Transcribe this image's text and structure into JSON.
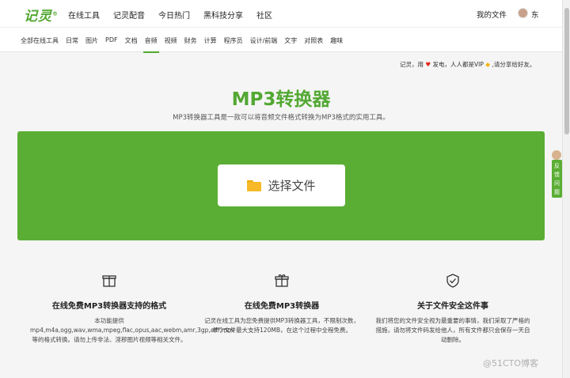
{
  "header": {
    "logo": "记灵",
    "logo_mark": "®",
    "nav": [
      "在线工具",
      "记灵配音",
      "今日热门",
      "黑科技分享",
      "社区"
    ],
    "my_files": "我的文件",
    "username": "东"
  },
  "categories": {
    "items": [
      "全部在线工具",
      "日常",
      "图片",
      "PDF",
      "文档",
      "音频",
      "视频",
      "财务",
      "计算",
      "程序员",
      "设计/前端",
      "文字",
      "对照表",
      "趣味"
    ],
    "active": "音频"
  },
  "notice": {
    "part1": "记灵，用",
    "heart": "♥",
    "part2": "发电，人人都是VIP",
    "vip": "◆",
    "part3": ",请分享给好友。"
  },
  "main": {
    "title": "MP3转换器",
    "subtitle": "MP3转换器工具是一款可以将音频文件格式转换为MP3格式的实用工具。",
    "select_label": "选择文件"
  },
  "features": [
    {
      "icon": "box-icon",
      "title": "在线免费MP3转换器支持的格式",
      "desc": "本功能提供mp4,m4a,ogg,wav,wma,mpeg,flac,opus,aac,webm,amr,3gp,aiff,mov等的格式转换。请勿上传非法、淫秽图片视频等相关文件。"
    },
    {
      "icon": "gift-icon",
      "title": "在线免费MP3转换器",
      "desc": "记灵在线工具为您免费提供MP3转换器工具，不限制次数，单个文件最大支持120MB，在这个过程中全程免费。"
    },
    {
      "icon": "shield-check-icon",
      "title": "关于文件安全这件事",
      "desc": "我们将您的文件安全视为最重要的事情，我们采取了严格的措施，请勿将文件码发给他人，所有文件都只会保存一天自动删除。"
    }
  ],
  "feedback": "反馈问题",
  "watermark": "@51CTO博客",
  "colors": {
    "accent": "#52a832",
    "upload_bg": "#5aae34"
  }
}
